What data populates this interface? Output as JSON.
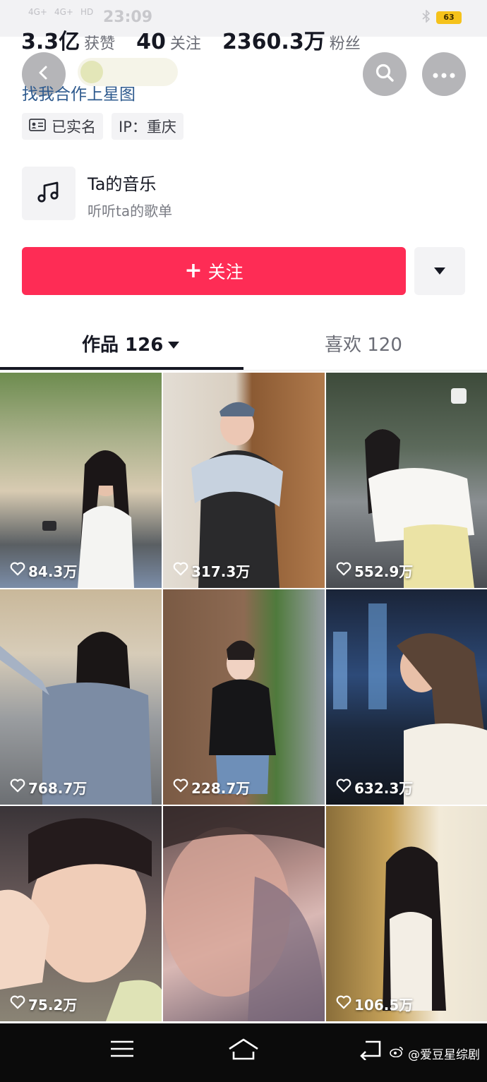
{
  "status_bar": {
    "net1": "4G+",
    "net2": "4G+",
    "hd": "HD",
    "time": "23:09",
    "battery": "63"
  },
  "stats": [
    {
      "value": "3.3亿",
      "label": "获赞"
    },
    {
      "value": "40",
      "label": "关注"
    },
    {
      "value": "2360.3万",
      "label": "粉丝"
    }
  ],
  "profile": {
    "link_text": "找我合作上星图",
    "tags": [
      {
        "icon": "id-card-icon",
        "label": "已实名"
      },
      {
        "icon": "",
        "label": "IP：重庆"
      }
    ]
  },
  "music": {
    "title": "Ta的音乐",
    "subtitle": "听听ta的歌单"
  },
  "actions": {
    "follow_label": "关注"
  },
  "tabs": [
    {
      "label": "作品 126",
      "active": true
    },
    {
      "label": "喜欢 120",
      "active": false
    }
  ],
  "videos": [
    {
      "likes": "84.3万"
    },
    {
      "likes": "317.3万"
    },
    {
      "likes": "552.9万"
    },
    {
      "likes": "768.7万"
    },
    {
      "likes": "228.7万"
    },
    {
      "likes": "632.3万"
    },
    {
      "likes": "75.2万"
    },
    {
      "likes": ""
    },
    {
      "likes": "106.5万"
    }
  ],
  "watermark": "@爱豆星综剧",
  "colors": {
    "accent": "#fe2c55",
    "link": "#2e5a8e",
    "text": "#161823"
  }
}
